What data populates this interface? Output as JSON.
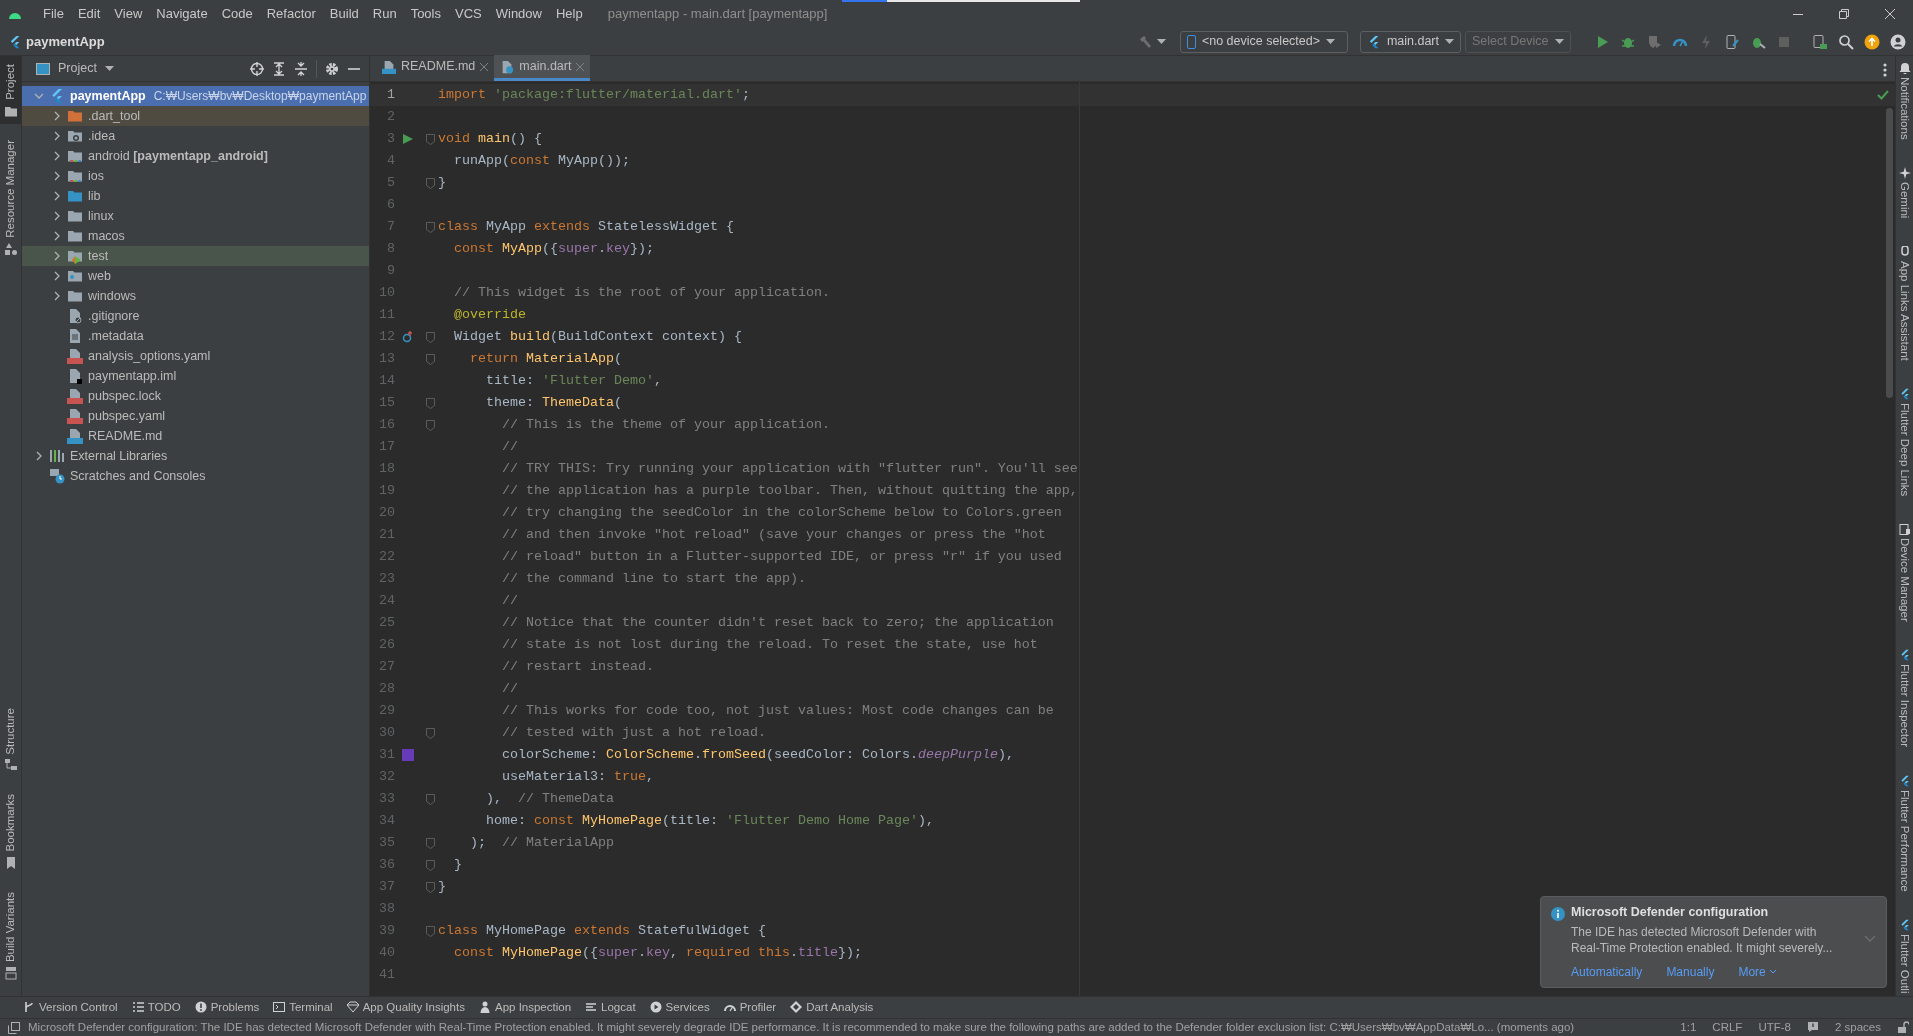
{
  "menu_bar": {
    "items": [
      "File",
      "Edit",
      "View",
      "Navigate",
      "Code",
      "Refactor",
      "Build",
      "Run",
      "Tools",
      "VCS",
      "Window",
      "Help"
    ],
    "title": "paymentapp - main.dart [paymentapp]"
  },
  "nav_bar": {
    "project": "paymentApp",
    "device_selector": "<no device selected>",
    "run_config": "main.dart",
    "target_selector": {
      "label": "Select Device",
      "disabled": true
    }
  },
  "left_tool_strip": {
    "top": [
      {
        "label": "Project",
        "selected": true
      },
      {
        "label": "Resource Manager",
        "selected": false
      }
    ],
    "bottom": [
      {
        "label": "Structure",
        "selected": false
      },
      {
        "label": "Bookmarks",
        "selected": false
      },
      {
        "label": "Build Variants",
        "selected": false
      }
    ]
  },
  "project_panel": {
    "title": "Project",
    "tree": [
      {
        "label": "paymentApp",
        "path": "C:₩Users₩bv₩Desktop₩paymentApp",
        "kind": "flutter-module",
        "expanded": true,
        "selected": true,
        "children": [
          {
            "label": ".dart_tool",
            "kind": "folder-excluded",
            "expanded": false,
            "selected": false
          },
          {
            "label": ".idea",
            "kind": "folder-idea",
            "expanded": false,
            "selected": false
          },
          {
            "label": "android **[paymentapp_android]**",
            "kind": "folder-module",
            "expanded": false,
            "selected": false
          },
          {
            "label": "ios",
            "kind": "folder-module",
            "expanded": false,
            "selected": false
          },
          {
            "label": "lib",
            "kind": "folder-source",
            "expanded": false,
            "selected": false
          },
          {
            "label": "linux",
            "kind": "folder",
            "expanded": false,
            "selected": false
          },
          {
            "label": "macos",
            "kind": "folder",
            "expanded": false,
            "selected": false
          },
          {
            "label": "test",
            "kind": "folder-test",
            "expanded": false,
            "selected": false
          },
          {
            "label": "web",
            "kind": "folder-web",
            "expanded": false,
            "selected": false
          },
          {
            "label": "windows",
            "kind": "folder",
            "expanded": false,
            "selected": false
          },
          {
            "label": ".gitignore",
            "kind": "file-ignore",
            "selected": false
          },
          {
            "label": ".metadata",
            "kind": "file-text",
            "selected": false
          },
          {
            "label": "analysis_options.yaml",
            "kind": "file-yaml",
            "selected": false
          },
          {
            "label": "paymentapp.iml",
            "kind": "file-iml",
            "selected": false
          },
          {
            "label": "pubspec.lock",
            "kind": "file-yaml",
            "selected": false
          },
          {
            "label": "pubspec.yaml",
            "kind": "file-yaml",
            "selected": false
          },
          {
            "label": "README.md",
            "kind": "file-md",
            "selected": false
          }
        ]
      },
      {
        "label": "External Libraries",
        "kind": "libraries",
        "expanded": false,
        "selected": false
      },
      {
        "label": "Scratches and Consoles",
        "kind": "scratches",
        "selected": false
      }
    ]
  },
  "editor": {
    "tabs": [
      {
        "label": "README.md",
        "kind": "markdown",
        "selected": false
      },
      {
        "label": "main.dart",
        "kind": "dart",
        "selected": true
      }
    ],
    "lines": [
      {
        "number": "1",
        "current": true,
        "tokens": [
          {
            "kind": "keyword",
            "text": "import "
          },
          {
            "kind": "string",
            "text": "'package:flutter/material.dart'"
          },
          {
            "kind": "plain",
            "text": ";"
          }
        ]
      },
      {
        "number": "2"
      },
      {
        "number": "3",
        "kind": "run",
        "fold": true,
        "tokens": [
          {
            "kind": "keyword",
            "text": "void "
          },
          {
            "kind": "function",
            "text": "main"
          },
          {
            "kind": "plain",
            "text": "() {"
          }
        ]
      },
      {
        "number": "4",
        "tokens": [
          {
            "kind": "plain",
            "text": "  runApp("
          },
          {
            "kind": "keyword",
            "text": "const "
          },
          {
            "kind": "plain",
            "text": "MyApp());"
          }
        ]
      },
      {
        "number": "5",
        "fold": true,
        "tokens": [
          {
            "kind": "plain",
            "text": "}"
          }
        ]
      },
      {
        "number": "6"
      },
      {
        "number": "7",
        "fold": true,
        "tokens": [
          {
            "kind": "keyword",
            "text": "class "
          },
          {
            "kind": "plain",
            "text": "MyApp "
          },
          {
            "kind": "keyword",
            "text": "extends "
          },
          {
            "kind": "plain",
            "text": "StatelessWidget {"
          }
        ]
      },
      {
        "number": "8",
        "tokens": [
          {
            "kind": "keyword",
            "text": "  const "
          },
          {
            "kind": "function",
            "text": "MyApp"
          },
          {
            "kind": "plain",
            "text": "({"
          },
          {
            "kind": "field",
            "text": "super"
          },
          {
            "kind": "plain",
            "text": "."
          },
          {
            "kind": "field",
            "text": "key"
          },
          {
            "kind": "plain",
            "text": "});"
          }
        ]
      },
      {
        "number": "9"
      },
      {
        "number": "10",
        "tokens": [
          {
            "kind": "comment",
            "text": "  // This widget is the root of your application."
          }
        ]
      },
      {
        "number": "11",
        "tokens": [
          {
            "kind": "annotation",
            "text": "  @override"
          }
        ]
      },
      {
        "number": "12",
        "kind": "override",
        "fold": true,
        "tokens": [
          {
            "kind": "plain",
            "text": "  Widget "
          },
          {
            "kind": "function",
            "text": "build"
          },
          {
            "kind": "plain",
            "text": "(BuildContext context) {"
          }
        ]
      },
      {
        "number": "13",
        "fold": true,
        "tokens": [
          {
            "kind": "keyword",
            "text": "    return "
          },
          {
            "kind": "function",
            "text": "MaterialApp"
          },
          {
            "kind": "plain",
            "text": "("
          }
        ]
      },
      {
        "number": "14",
        "tokens": [
          {
            "kind": "plain",
            "text": "      title: "
          },
          {
            "kind": "string",
            "text": "'Flutter Demo'"
          },
          {
            "kind": "plain",
            "text": ","
          }
        ]
      },
      {
        "number": "15",
        "fold": true,
        "tokens": [
          {
            "kind": "plain",
            "text": "      theme: "
          },
          {
            "kind": "function",
            "text": "ThemeData"
          },
          {
            "kind": "plain",
            "text": "("
          }
        ]
      },
      {
        "number": "16",
        "fold": true,
        "tokens": [
          {
            "kind": "comment",
            "text": "        // This is the theme of your application."
          }
        ]
      },
      {
        "number": "17",
        "tokens": [
          {
            "kind": "comment",
            "text": "        //"
          }
        ]
      },
      {
        "number": "18",
        "tokens": [
          {
            "kind": "comment",
            "text": "        // TRY THIS: Try running your application with \"flutter run\". You'll see"
          }
        ]
      },
      {
        "number": "19",
        "tokens": [
          {
            "kind": "comment",
            "text": "        // the application has a purple toolbar. Then, without quitting the app,"
          }
        ]
      },
      {
        "number": "20",
        "tokens": [
          {
            "kind": "comment",
            "text": "        // try changing the seedColor in the colorScheme below to Colors.green"
          }
        ]
      },
      {
        "number": "21",
        "tokens": [
          {
            "kind": "comment",
            "text": "        // and then invoke \"hot reload\" (save your changes or press the \"hot"
          }
        ]
      },
      {
        "number": "22",
        "tokens": [
          {
            "kind": "comment",
            "text": "        // reload\" button in a Flutter-supported IDE, or press \"r\" if you used"
          }
        ]
      },
      {
        "number": "23",
        "tokens": [
          {
            "kind": "comment",
            "text": "        // the command line to start the app)."
          }
        ]
      },
      {
        "number": "24",
        "tokens": [
          {
            "kind": "comment",
            "text": "        //"
          }
        ]
      },
      {
        "number": "25",
        "tokens": [
          {
            "kind": "comment",
            "text": "        // Notice that the counter didn't reset back to zero; the application"
          }
        ]
      },
      {
        "number": "26",
        "tokens": [
          {
            "kind": "comment",
            "text": "        // state is not lost during the reload. To reset the state, use hot"
          }
        ]
      },
      {
        "number": "27",
        "tokens": [
          {
            "kind": "comment",
            "text": "        // restart instead."
          }
        ]
      },
      {
        "number": "28",
        "tokens": [
          {
            "kind": "comment",
            "text": "        //"
          }
        ]
      },
      {
        "number": "29",
        "tokens": [
          {
            "kind": "comment",
            "text": "        // This works for code too, not just values: Most code changes can be"
          }
        ]
      },
      {
        "number": "30",
        "fold": true,
        "tokens": [
          {
            "kind": "comment",
            "text": "        // tested with just a hot reload."
          }
        ]
      },
      {
        "number": "31",
        "kind": "swatch",
        "color": "#673ab7",
        "tokens": [
          {
            "kind": "plain",
            "text": "        colorScheme: "
          },
          {
            "kind": "function",
            "text": "ColorScheme"
          },
          {
            "kind": "plain",
            "text": "."
          },
          {
            "kind": "function",
            "text": "fromSeed"
          },
          {
            "kind": "plain",
            "text": "(seedColor: Colors."
          },
          {
            "kind": "field-italic",
            "text": "deepPurple"
          },
          {
            "kind": "plain",
            "text": "),"
          }
        ]
      },
      {
        "number": "32",
        "tokens": [
          {
            "kind": "plain",
            "text": "        useMaterial3: "
          },
          {
            "kind": "keyword",
            "text": "true"
          },
          {
            "kind": "plain",
            "text": ","
          }
        ]
      },
      {
        "number": "33",
        "fold": true,
        "tokens": [
          {
            "kind": "plain",
            "text": "      ),  "
          },
          {
            "kind": "comment",
            "text": "// ThemeData"
          }
        ]
      },
      {
        "number": "34",
        "tokens": [
          {
            "kind": "plain",
            "text": "      home: "
          },
          {
            "kind": "keyword",
            "text": "const "
          },
          {
            "kind": "function",
            "text": "MyHomePage"
          },
          {
            "kind": "plain",
            "text": "(title: "
          },
          {
            "kind": "string",
            "text": "'Flutter Demo Home Page'"
          },
          {
            "kind": "plain",
            "text": "),"
          }
        ]
      },
      {
        "number": "35",
        "fold": true,
        "tokens": [
          {
            "kind": "plain",
            "text": "    );  "
          },
          {
            "kind": "comment",
            "text": "// MaterialApp"
          }
        ]
      },
      {
        "number": "36",
        "fold": true,
        "tokens": [
          {
            "kind": "plain",
            "text": "  }"
          }
        ]
      },
      {
        "number": "37",
        "fold": true,
        "tokens": [
          {
            "kind": "plain",
            "text": "}"
          }
        ]
      },
      {
        "number": "38"
      },
      {
        "number": "39",
        "fold": true,
        "tokens": [
          {
            "kind": "keyword",
            "text": "class "
          },
          {
            "kind": "plain",
            "text": "MyHomePage "
          },
          {
            "kind": "keyword",
            "text": "extends "
          },
          {
            "kind": "plain",
            "text": "StatefulWidget {"
          }
        ]
      },
      {
        "number": "40",
        "tokens": [
          {
            "kind": "keyword",
            "text": "  const "
          },
          {
            "kind": "function",
            "text": "MyHomePage"
          },
          {
            "kind": "plain",
            "text": "({"
          },
          {
            "kind": "field",
            "text": "super"
          },
          {
            "kind": "plain",
            "text": "."
          },
          {
            "kind": "field",
            "text": "key"
          },
          {
            "kind": "plain",
            "text": ", "
          },
          {
            "kind": "keyword",
            "text": "required this"
          },
          {
            "kind": "plain",
            "text": "."
          },
          {
            "kind": "field",
            "text": "title"
          },
          {
            "kind": "plain",
            "text": "});"
          }
        ]
      },
      {
        "number": "41"
      }
    ]
  },
  "notification": {
    "title": "Microsoft Defender configuration",
    "body": "The IDE has detected Microsoft Defender with Real-Time Protection enabled. It might severely...",
    "actions": [
      "Automatically",
      "Manually",
      "More"
    ]
  },
  "right_tool_strip": [
    "Notifications",
    "Gemini",
    "App Links Assistant",
    "Flutter Deep Links",
    "Device Manager",
    "Flutter Inspector",
    "Flutter Performance",
    "Flutter Outli"
  ],
  "tool_window_bar": [
    "Version Control",
    "TODO",
    "Problems",
    "Terminal",
    "App Quality Insights",
    "App Inspection",
    "Logcat",
    "Services",
    "Profiler",
    "Dart Analysis"
  ],
  "status_bar": {
    "message": "Microsoft Defender configuration: The IDE has detected Microsoft Defender with Real-Time Protection enabled. It might severely degrade IDE performance. It is recommended to make sure the following paths are added to the Defender folder exclusion list: C:₩Users₩bv₩AppData₩Lo... (moments ago)",
    "position": "1:1",
    "line_separator": "CRLF",
    "encoding": "UTF-8",
    "indent": "2 spaces"
  }
}
